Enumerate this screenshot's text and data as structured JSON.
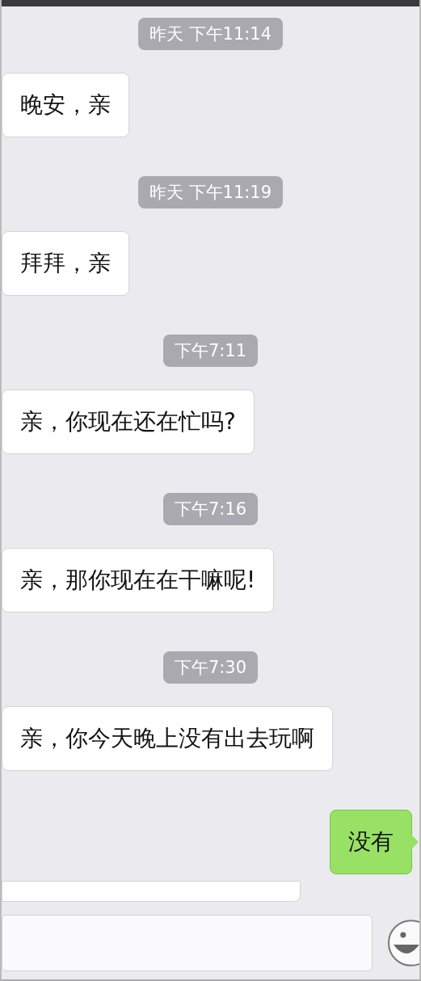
{
  "messages": [
    {
      "kind": "time",
      "text": "昨天 下午11:14"
    },
    {
      "kind": "incoming",
      "text": "晚安，亲"
    },
    {
      "kind": "time",
      "text": "昨天 下午11:19"
    },
    {
      "kind": "incoming",
      "text": "拜拜，亲"
    },
    {
      "kind": "time",
      "text": "下午7:11"
    },
    {
      "kind": "incoming",
      "text": "亲，你现在还在忙吗?"
    },
    {
      "kind": "time",
      "text": "下午7:16"
    },
    {
      "kind": "incoming",
      "text": "亲，那你现在在干嘛呢!"
    },
    {
      "kind": "time",
      "text": "下午7:30"
    },
    {
      "kind": "incoming",
      "text": "亲，你今天晚上没有出去玩啊"
    },
    {
      "kind": "outgoing",
      "text": "没有"
    }
  ]
}
